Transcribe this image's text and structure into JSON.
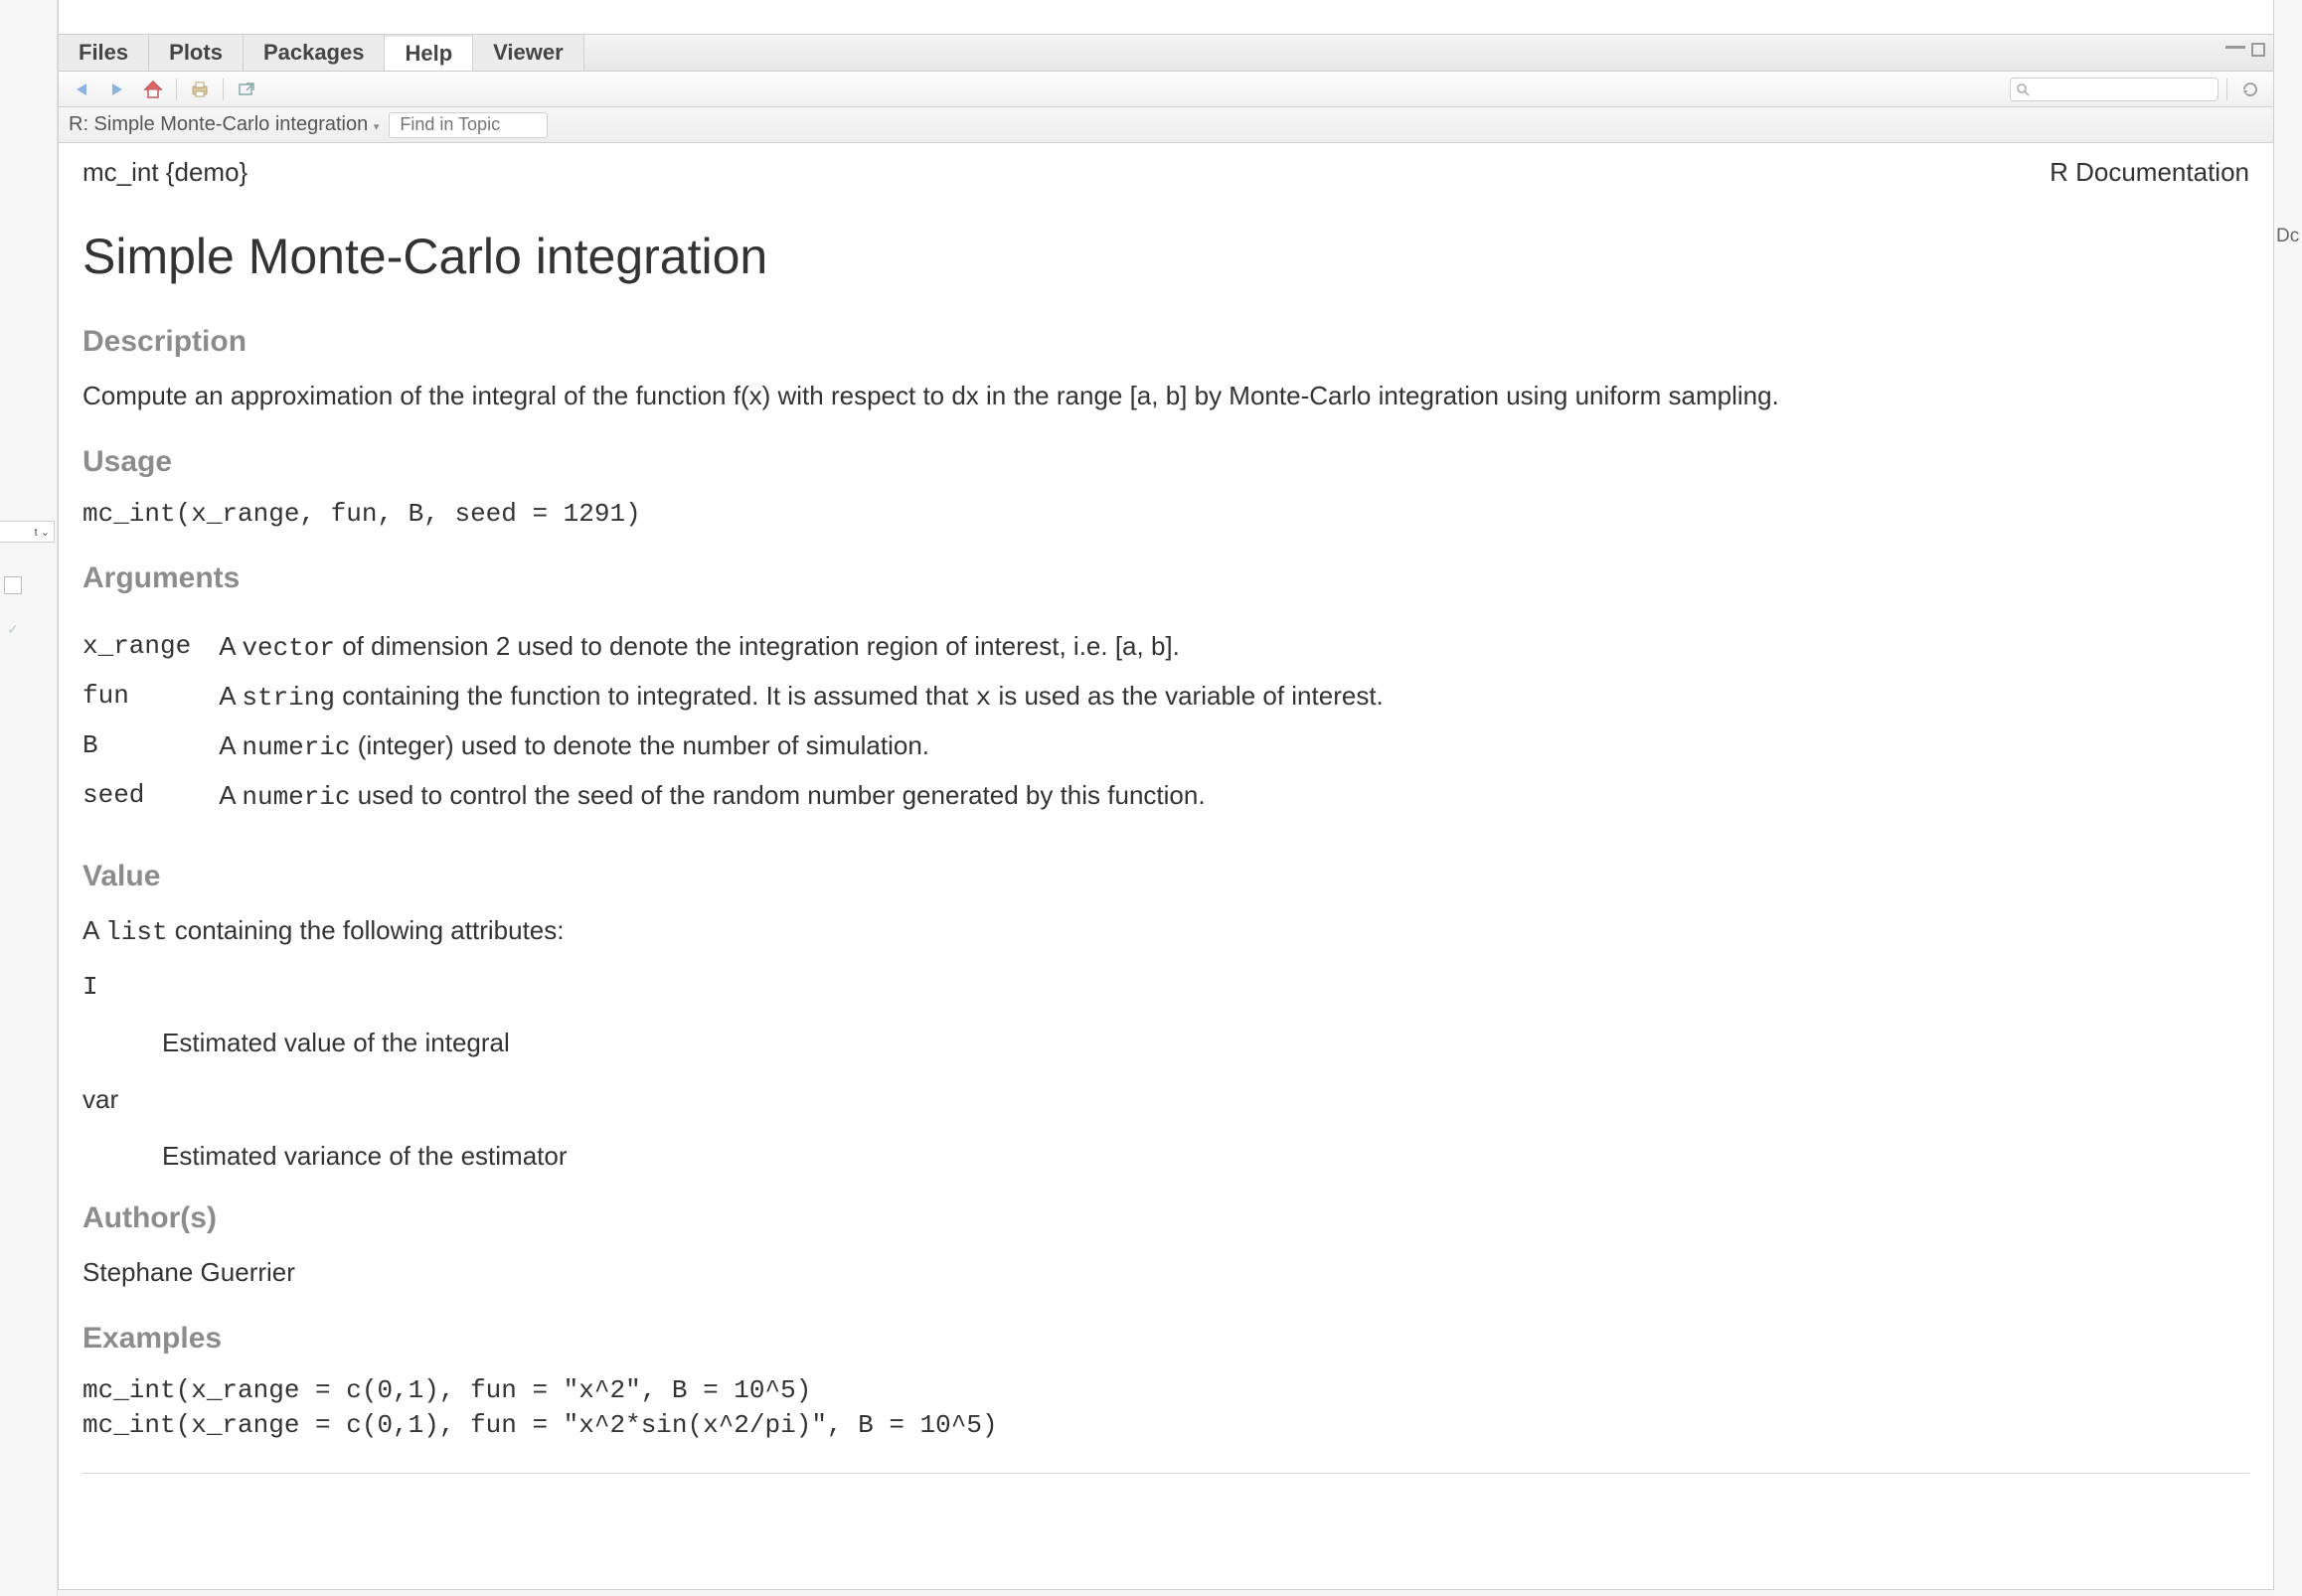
{
  "tabs": {
    "files": "Files",
    "plots": "Plots",
    "packages": "Packages",
    "help": "Help",
    "viewer": "Viewer"
  },
  "breadcrumb": {
    "text": "R: Simple Monte-Carlo integration",
    "find_placeholder": "Find in Topic"
  },
  "doc": {
    "func": "mc_int {demo}",
    "rdoc": "R Documentation",
    "title": "Simple Monte-Carlo integration",
    "desc_h": "Description",
    "desc_text": "Compute an approximation of the integral of the function f(x) with respect to dx in the range [a, b] by Monte-Carlo integration using uniform sampling.",
    "usage_h": "Usage",
    "usage_code": "mc_int(x_range, fun, B, seed = 1291)",
    "args_h": "Arguments",
    "args": [
      {
        "name": "x_range",
        "prefix": "A ",
        "code": "vector",
        "rest": " of dimension 2 used to denote the integration region of interest, i.e. [a, b]."
      },
      {
        "name": "fun",
        "prefix": "A ",
        "code": "string",
        "rest_1": " containing the function to integrated. It is assumed that ",
        "code2": "x",
        "rest_2": " is used as the variable of interest."
      },
      {
        "name": "B",
        "prefix": "A ",
        "code": "numeric",
        "rest": " (integer) used to denote the number of simulation."
      },
      {
        "name": "seed",
        "prefix": "A ",
        "code": "numeric",
        "rest": " used to control the seed of the random number generated by this function."
      }
    ],
    "value_h": "Value",
    "value_intro_pre": "A ",
    "value_intro_code": "list",
    "value_intro_post": " containing the following attributes:",
    "value_items": [
      {
        "name": "I",
        "mono": true,
        "desc": "Estimated value of the integral"
      },
      {
        "name": "var",
        "mono": false,
        "desc": "Estimated variance of the estimator"
      }
    ],
    "author_h": "Author(s)",
    "author": "Stephane Guerrier",
    "examples_h": "Examples",
    "examples_code": "mc_int(x_range = c(0,1), fun = \"x^2\", B = 10^5)\nmc_int(x_range = c(0,1), fun = \"x^2*sin(x^2/pi)\", B = 10^5)"
  }
}
